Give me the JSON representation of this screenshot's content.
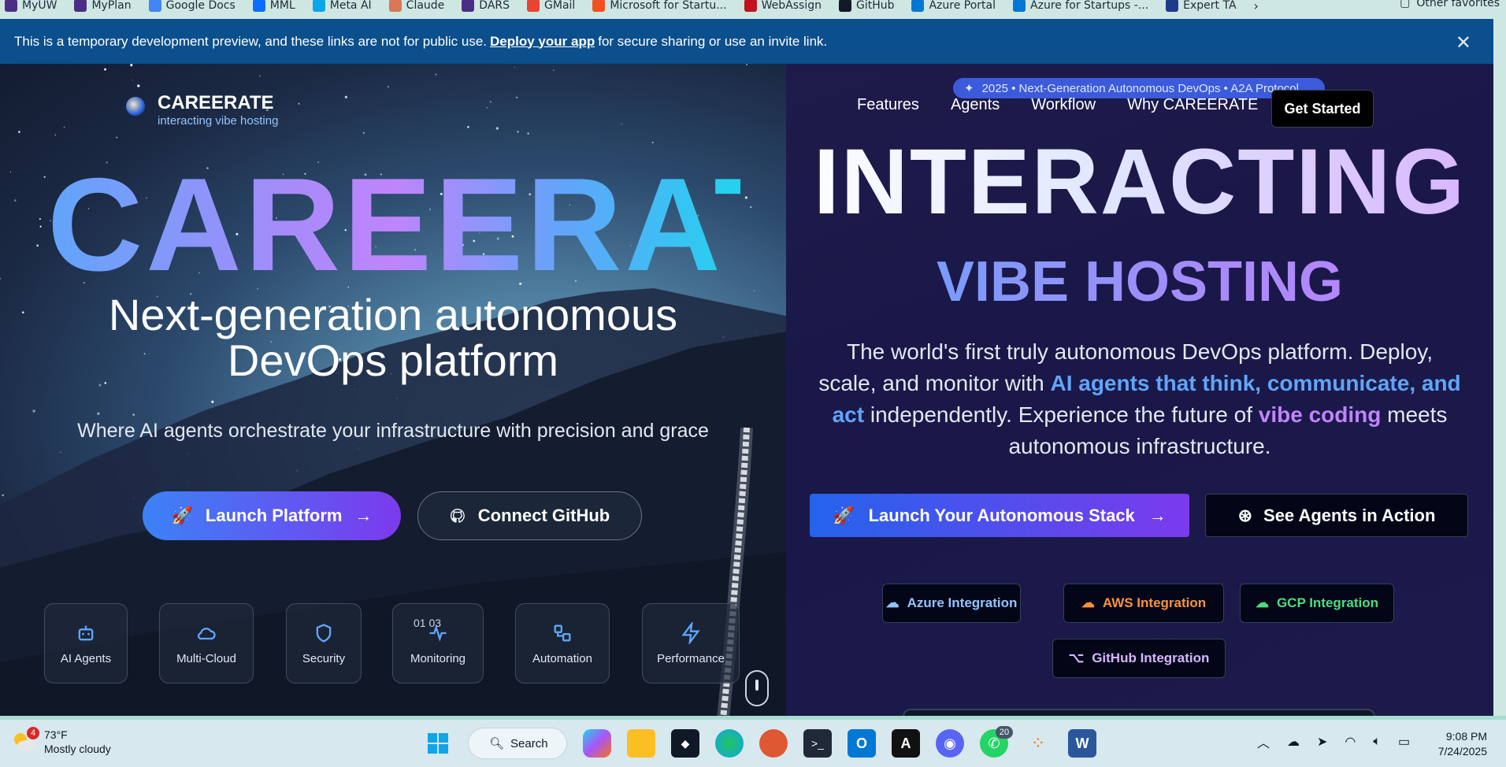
{
  "bookmarks": [
    {
      "label": "MyUW",
      "icon": "uw-icon",
      "color": "#4b2e83"
    },
    {
      "label": "MyPlan",
      "icon": "uw-icon",
      "color": "#4b2e83"
    },
    {
      "label": "Google Docs",
      "icon": "docs-icon",
      "color": "#4285f4"
    },
    {
      "label": "MML",
      "icon": "pearson-icon",
      "color": "#0d6efd"
    },
    {
      "label": "Meta AI",
      "icon": "meta-icon",
      "color": "#0ea5e9"
    },
    {
      "label": "Claude",
      "icon": "claude-icon",
      "color": "#d97757"
    },
    {
      "label": "DARS",
      "icon": "uw-icon",
      "color": "#4b2e83"
    },
    {
      "label": "GMail",
      "icon": "gmail-icon",
      "color": "#ea4335"
    },
    {
      "label": "Microsoft for Startu...",
      "icon": "microsoft-icon",
      "color": "#f25022"
    },
    {
      "label": "WebAssign",
      "icon": "webassign-icon",
      "color": "#c1121f"
    },
    {
      "label": "GitHub",
      "icon": "github-icon",
      "color": "#111827"
    },
    {
      "label": "Azure Portal",
      "icon": "azure-icon",
      "color": "#0078d4"
    },
    {
      "label": "Azure for Startups -...",
      "icon": "azure-icon",
      "color": "#0078d4"
    },
    {
      "label": "Expert TA",
      "icon": "expertta-icon",
      "color": "#1e3a8a"
    }
  ],
  "bookmarks_other": "Other favorites",
  "banner": {
    "text_before": "This is a temporary development preview, and these links are not for public use.",
    "link": "Deploy your app",
    "text_after": "for secure sharing or use an invite link."
  },
  "hero": {
    "brand_name": "CAREERATE",
    "brand_tagline": "interacting vibe hosting",
    "title": "CAREERATE",
    "subtitle_line1": "Next-generation autonomous",
    "subtitle_line2": "DevOps platform",
    "description": "Where AI agents orchestrate your infrastructure with precision and grace",
    "launch_button": "Launch Platform",
    "github_button": "Connect GitHub",
    "features": [
      {
        "label": "AI Agents",
        "icon": "bot-icon"
      },
      {
        "label": "Multi-Cloud",
        "icon": "cloud-icon"
      },
      {
        "label": "Security",
        "icon": "shield-icon"
      },
      {
        "label": "Monitoring",
        "icon": "activity-icon"
      },
      {
        "label": "Automation",
        "icon": "workflow-icon"
      },
      {
        "label": "Performance",
        "icon": "zap-icon"
      }
    ],
    "monitoring_overlay": "01 03"
  },
  "right": {
    "pill": "2025 • Next-Generation Autonomous DevOps • A2A Protocol",
    "nav": [
      "Features",
      "Agents",
      "Workflow",
      "Why CAREERATE"
    ],
    "get_started": "Get Started",
    "headline": "INTERACTING",
    "subheadline": "VIBE HOSTING",
    "para_1": "The world's first truly autonomous DevOps platform. Deploy, scale, and monitor with ",
    "para_hl1": "AI agents that think, communicate, and act",
    "para_2": " independently. Experience the future of ",
    "para_hl2": "vibe coding",
    "para_3": " meets autonomous infrastructure.",
    "cta_primary": "Launch Your Autonomous Stack",
    "cta_secondary": "See Agents in Action",
    "integrations": [
      {
        "label": "Azure Integration",
        "color": "#93c5fd"
      },
      {
        "label": "AWS Integration",
        "color": "#fb923c"
      },
      {
        "label": "GCP Integration",
        "color": "#4ade80"
      },
      {
        "label": "GitHub Integration",
        "color": "#d8b4fe"
      }
    ]
  },
  "taskbar": {
    "weather_temp": "73°F",
    "weather_desc": "Mostly cloudy",
    "weather_badge": "4",
    "search_label": "Search",
    "apps": [
      "start-icon",
      "search",
      "copilot-icon",
      "file-explorer-icon",
      "roblox-icon",
      "edge-icon",
      "duckduckgo-icon",
      "terminal-icon",
      "outlook-icon",
      "notion-icon",
      "discord-icon",
      "whatsapp-icon",
      "figma-icon",
      "word-icon"
    ],
    "whatsapp_badge": "20",
    "time": "9:08 PM",
    "date": "7/24/2025"
  }
}
